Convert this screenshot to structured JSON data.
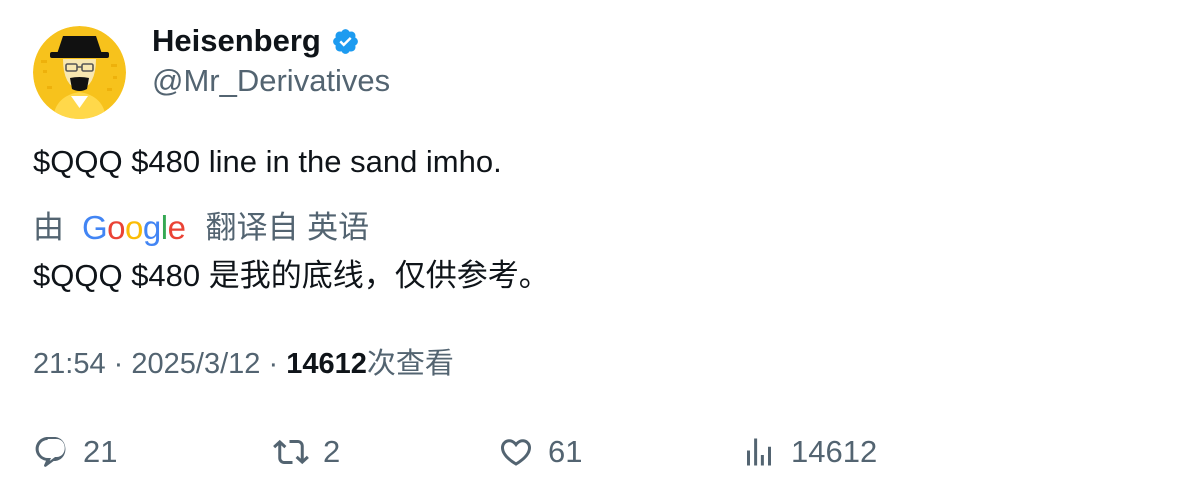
{
  "user": {
    "display_name": "Heisenberg",
    "handle": "@Mr_Derivatives",
    "verified_icon": "verified-badge-icon",
    "avatar_icon": "heisenberg-avatar"
  },
  "tweet": {
    "text": "$QQQ $480 line in the sand imho.",
    "translation": {
      "prefix": "由",
      "provider_letters": [
        "G",
        "o",
        "o",
        "g",
        "l",
        "e"
      ],
      "suffix": "翻译自 英语",
      "text": "$QQQ $480 是我的底线，仅供参考。"
    },
    "time": "21:54",
    "separator": "·",
    "date": "2025/3/12",
    "views": "14612",
    "views_label": "次查看"
  },
  "actions": {
    "reply_count": "21",
    "retweet_count": "2",
    "like_count": "61",
    "views_count": "14612"
  },
  "colors": {
    "text": "#0f1419",
    "secondary": "#536471",
    "verified": "#1d9bf0",
    "avatar_bg": "#f5c518"
  }
}
